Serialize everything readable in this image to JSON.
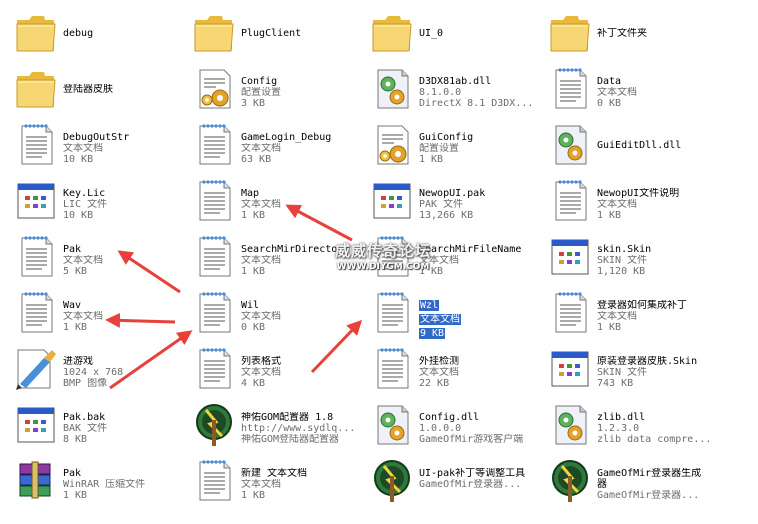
{
  "colors": {
    "arrow": "#e8403a",
    "selection": "#316ac5",
    "folder": "#f6d56a"
  },
  "watermark": {
    "text": "威威传奇论坛",
    "url": "WWW.DIYGM.COM"
  },
  "items": [
    {
      "name": "debug",
      "icon": "folder-icon"
    },
    {
      "name": "PlugClient",
      "icon": "folder-icon"
    },
    {
      "name": "UI_0",
      "icon": "folder-icon"
    },
    {
      "name": "补丁文件夹",
      "icon": "folder-icon"
    },
    {
      "name": "登陆器皮肤",
      "icon": "folder-icon"
    },
    {
      "name": "Config",
      "type": "配置设置",
      "size": "3 KB",
      "icon": "config-file-icon"
    },
    {
      "name": "D3DX81ab.dll",
      "type": "8.1.0.0",
      "size": "DirectX 8.1 D3DX...",
      "icon": "dll-file-icon"
    },
    {
      "name": "Data",
      "type": "文本文档",
      "size": "0 KB",
      "icon": "text-file-icon"
    },
    {
      "name": "DebugOutStr",
      "type": "文本文档",
      "size": "10 KB",
      "icon": "text-file-icon"
    },
    {
      "name": "GameLogin_Debug",
      "type": "文本文档",
      "size": "63 KB",
      "icon": "text-file-icon"
    },
    {
      "name": "GuiConfig",
      "type": "配置设置",
      "size": "1 KB",
      "icon": "config-file-icon"
    },
    {
      "name": "GuiEditDll.dll",
      "icon": "dll-file-icon"
    },
    {
      "name": "Key.Lic",
      "type": "LIC 文件",
      "size": "10 KB",
      "icon": "window-file-icon"
    },
    {
      "name": "Map",
      "type": "文本文档",
      "size": "1 KB",
      "icon": "text-file-icon"
    },
    {
      "name": "NewopUI.pak",
      "type": "PAK 文件",
      "size": "13,266 KB",
      "icon": "window-file-icon"
    },
    {
      "name": "NewopUI文件说明",
      "type": "文本文档",
      "size": "1 KB",
      "icon": "text-file-icon"
    },
    {
      "name": "Pak",
      "type": "文本文档",
      "size": "5 KB",
      "icon": "text-file-icon"
    },
    {
      "name": "SearchMirDirectory",
      "type": "文本文档",
      "size": "1 KB",
      "icon": "text-file-icon"
    },
    {
      "name": "SearchMirFileName",
      "type": "文本文档",
      "size": "1 KB",
      "icon": "text-file-icon"
    },
    {
      "name": "skin.Skin",
      "type": "SKIN 文件",
      "size": "1,120 KB",
      "icon": "window-file-icon"
    },
    {
      "name": "Wav",
      "type": "文本文档",
      "size": "1 KB",
      "icon": "text-file-icon"
    },
    {
      "name": "Wil",
      "type": "文本文档",
      "size": "0 KB",
      "icon": "text-file-icon"
    },
    {
      "name": "Wzl",
      "type": "文本文档",
      "size": "9 KB",
      "icon": "text-file-icon",
      "selected": true
    },
    {
      "name": "登录器如何集成补丁",
      "type": "文本文档",
      "size": "1 KB",
      "icon": "text-file-icon"
    },
    {
      "name": "进游戏",
      "type": "1024 x 768",
      "size": "BMP 图像",
      "icon": "bmp-file-icon"
    },
    {
      "name": "列表格式",
      "type": "文本文档",
      "size": "4 KB",
      "icon": "text-file-icon"
    },
    {
      "name": "外挂检测",
      "type": "文本文档",
      "size": "22 KB",
      "icon": "text-file-icon"
    },
    {
      "name": "原装登录器皮肤.Skin",
      "type": "SKIN 文件",
      "size": "743 KB",
      "icon": "window-file-icon"
    },
    {
      "name": "Pak.bak",
      "type": "BAK 文件",
      "size": "8 KB",
      "icon": "window-file-icon"
    },
    {
      "name": "神佑GOM配置器 1.8",
      "type": "http://www.sydlq...",
      "size": "神佑GOM登陆器配置器",
      "icon": "app-exe-icon"
    },
    {
      "name": "Config.dll",
      "type": "1.0.0.0",
      "size": "GameOfMir游戏客户端",
      "icon": "dll-file-icon"
    },
    {
      "name": "zlib.dll",
      "type": "1.2.3.0",
      "size": "zlib data compre...",
      "icon": "dll-file-icon"
    },
    {
      "name": "Pak",
      "type": "WinRAR 压缩文件",
      "size": "1 KB",
      "icon": "winrar-archive-icon"
    },
    {
      "name": "新建 文本文档",
      "type": "文本文档",
      "size": "1 KB",
      "icon": "text-file-icon"
    },
    {
      "name": "UI-pak补丁等调整工具",
      "type": "GameOfMir登录器...",
      "icon": "app-exe-icon",
      "wrap": true
    },
    {
      "name": "GameOfMir登录器生成器",
      "type": "GameOfMir登录器...",
      "icon": "app-exe-icon",
      "wrap": true
    }
  ]
}
